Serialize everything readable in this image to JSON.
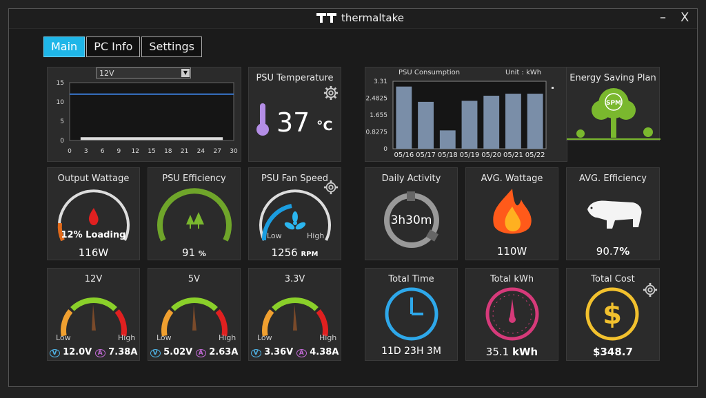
{
  "window": {
    "brand": "thermaltake",
    "minimize": "–",
    "close": "X"
  },
  "tabs": [
    {
      "label": "Main"
    },
    {
      "label": "PC Info"
    },
    {
      "label": "Settings"
    }
  ],
  "rail_chart": {
    "select_value": "12V",
    "chart_data": {
      "type": "line",
      "x_ticks": [
        "0",
        "3",
        "6",
        "9",
        "12",
        "15",
        "18",
        "21",
        "24",
        "27",
        "30"
      ],
      "y_ticks": [
        "0",
        "5",
        "10",
        "15"
      ],
      "ylim": [
        0,
        15
      ],
      "xlim": [
        0,
        30
      ],
      "series": [
        {
          "color": "#3a7bd5",
          "x": [
            0,
            30
          ],
          "y": [
            12,
            12
          ]
        },
        {
          "color": "#dddddd",
          "x": [
            2,
            28
          ],
          "y": [
            0.5,
            0.5
          ]
        }
      ]
    }
  },
  "psu_temperature": {
    "title": "PSU Temperature",
    "value": "37",
    "unit": "°C"
  },
  "consumption": {
    "title": "PSU Consumption",
    "unit_label": "Unit : kWh",
    "chart_data": {
      "type": "bar",
      "categories": [
        "05/16",
        "05/17",
        "05/18",
        "05/19",
        "05/20",
        "05/21",
        "05/22"
      ],
      "values": [
        3.05,
        2.3,
        0.9,
        2.35,
        2.6,
        2.7,
        2.7
      ],
      "y_ticks": [
        "0",
        "0.8275",
        "1.655",
        "2.4825",
        "3.31"
      ],
      "ylim": [
        0,
        3.31
      ],
      "color": "#7a8ea8"
    }
  },
  "energy_plan": {
    "title": "Energy Saving Plan",
    "logo_text": "SPM"
  },
  "output_wattage": {
    "title": "Output Wattage",
    "loading": "12% Loading",
    "value": "116W",
    "level": 0.12
  },
  "psu_efficiency": {
    "title": "PSU Efficiency",
    "value": "91",
    "unit": "%",
    "level": 0.91
  },
  "fan_speed": {
    "title": "PSU Fan Speed",
    "low": "Low",
    "high": "High",
    "value": "1256",
    "unit": "RPM"
  },
  "daily_activity": {
    "title": "Daily Activity",
    "value": "3h30m"
  },
  "avg_wattage": {
    "title": "AVG. Wattage",
    "value": "110W"
  },
  "avg_efficiency": {
    "title": "AVG. Efficiency",
    "value": "90.7",
    "unit": "%"
  },
  "rails": [
    {
      "title": "12V",
      "low": "Low",
      "high": "High",
      "v_icon": "V",
      "volts": "12.0V",
      "a_icon": "A",
      "amps": "7.38A"
    },
    {
      "title": "5V",
      "low": "Low",
      "high": "High",
      "v_icon": "V",
      "volts": "5.02V",
      "a_icon": "A",
      "amps": "2.63A"
    },
    {
      "title": "3.3V",
      "low": "Low",
      "high": "High",
      "v_icon": "V",
      "volts": "3.36V",
      "a_icon": "A",
      "amps": "4.38A"
    }
  ],
  "total_time": {
    "title": "Total Time",
    "value": "11D 23H 3M"
  },
  "total_kwh": {
    "title": "Total kWh",
    "value": "35.1",
    "unit": "kWh"
  },
  "total_cost": {
    "title": "Total Cost",
    "value": "$348.7"
  }
}
